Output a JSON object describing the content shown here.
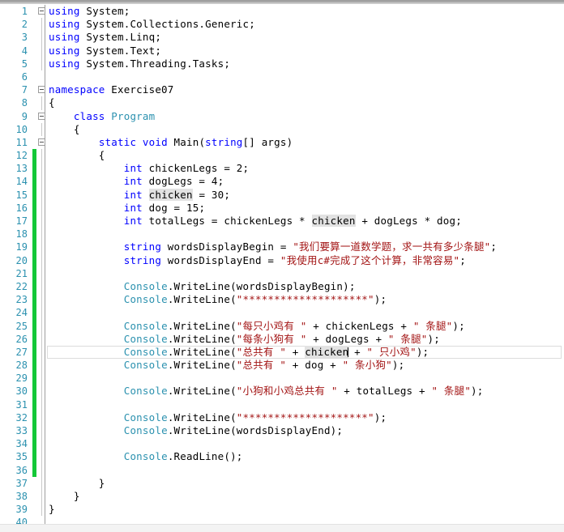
{
  "app": {
    "kind": "code-editor",
    "language": "C#",
    "theme": "visual-studio-light",
    "colors": {
      "background": "#ffffff",
      "line_number": "#2b91af",
      "keyword": "#0000ff",
      "type": "#2b91af",
      "string": "#a31515",
      "plain_text": "#000000",
      "change_bar_saved": "#14c838",
      "highlight_word": "#e2e2e2",
      "current_line_border": "#dcdcdc",
      "gutter_separator": "#9e9e9e"
    },
    "current_line": 27,
    "caret": {
      "line": 27,
      "after_token": "chicken"
    },
    "highlighted_word": "chicken",
    "change_bar_range": {
      "from": 12,
      "to": 36
    },
    "total_lines_visible": 40
  },
  "code": {
    "lines": [
      {
        "n": 1,
        "glyph": "collapse",
        "indent_level": 0,
        "text": "using System;"
      },
      {
        "n": 2,
        "glyph": "",
        "indent_level": 0,
        "text": "using System.Collections.Generic;"
      },
      {
        "n": 3,
        "glyph": "",
        "indent_level": 0,
        "text": "using System.Linq;"
      },
      {
        "n": 4,
        "glyph": "",
        "indent_level": 0,
        "text": "using System.Text;"
      },
      {
        "n": 5,
        "glyph": "",
        "indent_level": 0,
        "text": "using System.Threading.Tasks;"
      },
      {
        "n": 6,
        "glyph": "",
        "indent_level": 0,
        "text": ""
      },
      {
        "n": 7,
        "glyph": "collapse",
        "indent_level": 0,
        "text": "namespace Exercise07"
      },
      {
        "n": 8,
        "glyph": "",
        "indent_level": 0,
        "text": "{"
      },
      {
        "n": 9,
        "glyph": "collapse",
        "indent_level": 1,
        "text": "    class Program"
      },
      {
        "n": 10,
        "glyph": "",
        "indent_level": 1,
        "text": "    {"
      },
      {
        "n": 11,
        "glyph": "collapse",
        "indent_level": 2,
        "text": "        static void Main(string[] args)"
      },
      {
        "n": 12,
        "glyph": "",
        "indent_level": 2,
        "text": "        {"
      },
      {
        "n": 13,
        "glyph": "",
        "indent_level": 3,
        "text": "            int chickenLegs = 2;"
      },
      {
        "n": 14,
        "glyph": "",
        "indent_level": 3,
        "text": "            int dogLegs = 4;"
      },
      {
        "n": 15,
        "glyph": "",
        "indent_level": 3,
        "text": "            int chicken = 30;"
      },
      {
        "n": 16,
        "glyph": "",
        "indent_level": 3,
        "text": "            int dog = 15;"
      },
      {
        "n": 17,
        "glyph": "",
        "indent_level": 3,
        "text": "            int totalLegs = chickenLegs * chicken + dogLegs * dog;"
      },
      {
        "n": 18,
        "glyph": "",
        "indent_level": 3,
        "text": ""
      },
      {
        "n": 19,
        "glyph": "",
        "indent_level": 3,
        "text": "            string wordsDisplayBegin = \"我们要算一道数学题，求一共有多少条腿\";"
      },
      {
        "n": 20,
        "glyph": "",
        "indent_level": 3,
        "text": "            string wordsDisplayEnd = \"我使用c#完成了这个计算，非常容易\";"
      },
      {
        "n": 21,
        "glyph": "",
        "indent_level": 3,
        "text": ""
      },
      {
        "n": 22,
        "glyph": "",
        "indent_level": 3,
        "text": "            Console.WriteLine(wordsDisplayBegin);"
      },
      {
        "n": 23,
        "glyph": "",
        "indent_level": 3,
        "text": "            Console.WriteLine(\"********************\");"
      },
      {
        "n": 24,
        "glyph": "",
        "indent_level": 3,
        "text": ""
      },
      {
        "n": 25,
        "glyph": "",
        "indent_level": 3,
        "text": "            Console.WriteLine(\"每只小鸡有 \" + chickenLegs + \" 条腿\");"
      },
      {
        "n": 26,
        "glyph": "",
        "indent_level": 3,
        "text": "            Console.WriteLine(\"每条小狗有 \" + dogLegs + \" 条腿\");"
      },
      {
        "n": 27,
        "glyph": "",
        "indent_level": 3,
        "text": "            Console.WriteLine(\"总共有 \" + chicken + \" 只小鸡\");"
      },
      {
        "n": 28,
        "glyph": "",
        "indent_level": 3,
        "text": "            Console.WriteLine(\"总共有 \" + dog + \" 条小狗\");"
      },
      {
        "n": 29,
        "glyph": "",
        "indent_level": 3,
        "text": ""
      },
      {
        "n": 30,
        "glyph": "",
        "indent_level": 3,
        "text": "            Console.WriteLine(\"小狗和小鸡总共有 \" + totalLegs + \" 条腿\");"
      },
      {
        "n": 31,
        "glyph": "",
        "indent_level": 3,
        "text": ""
      },
      {
        "n": 32,
        "glyph": "",
        "indent_level": 3,
        "text": "            Console.WriteLine(\"********************\");"
      },
      {
        "n": 33,
        "glyph": "",
        "indent_level": 3,
        "text": "            Console.WriteLine(wordsDisplayEnd);"
      },
      {
        "n": 34,
        "glyph": "",
        "indent_level": 3,
        "text": ""
      },
      {
        "n": 35,
        "glyph": "",
        "indent_level": 3,
        "text": "            Console.ReadLine();"
      },
      {
        "n": 36,
        "glyph": "",
        "indent_level": 3,
        "text": ""
      },
      {
        "n": 37,
        "glyph": "",
        "indent_level": 2,
        "text": "        }"
      },
      {
        "n": 38,
        "glyph": "",
        "indent_level": 1,
        "text": "    }"
      },
      {
        "n": 39,
        "glyph": "",
        "indent_level": 0,
        "text": "}"
      },
      {
        "n": 40,
        "glyph": "",
        "indent_level": 0,
        "text": ""
      }
    ]
  },
  "tokens": {
    "keywords": [
      "using",
      "namespace",
      "class",
      "static",
      "void",
      "int",
      "string"
    ],
    "types": [
      "Program",
      "Console"
    ],
    "strings": [
      "我们要算一道数学题，求一共有多少条腿",
      "我使用c#完成了这个计算，非常容易",
      "********************",
      "每只小鸡有 ",
      " 条腿",
      "每条小狗有 ",
      "总共有 ",
      " 只小鸡",
      " 条小狗",
      "小狗和小鸡总共有 "
    ],
    "identifiers": [
      "System",
      "System.Collections.Generic",
      "System.Linq",
      "System.Text",
      "System.Threading.Tasks",
      "Exercise07",
      "Main",
      "args",
      "chickenLegs",
      "dogLegs",
      "chicken",
      "dog",
      "totalLegs",
      "wordsDisplayBegin",
      "wordsDisplayEnd",
      "WriteLine",
      "ReadLine"
    ],
    "numbers": [
      "2",
      "4",
      "30",
      "15"
    ]
  }
}
